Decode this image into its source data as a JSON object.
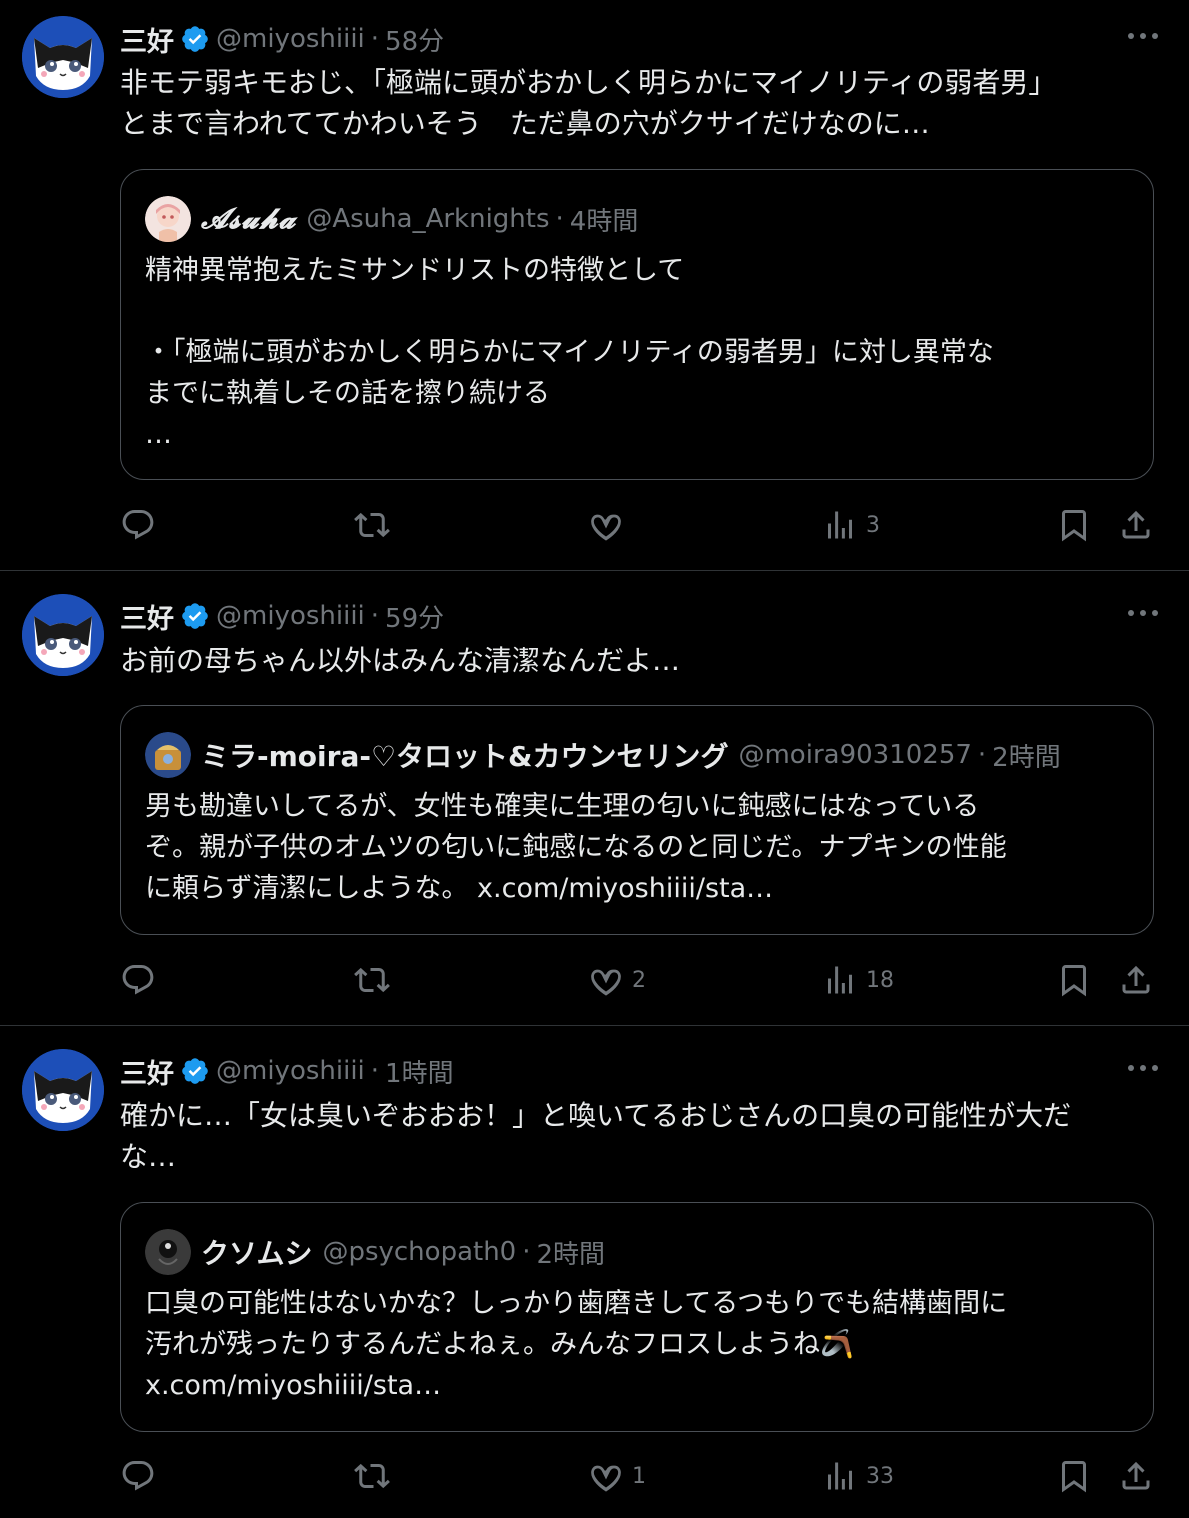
{
  "tweets": [
    {
      "name": "三好",
      "handle": "@miyoshiiii",
      "time": "58分",
      "text": "非モテ弱キモおじ、「極端に頭がおかしく明らかにマイノリティの弱者男」\nとまで言われててかわいそう　ただ鼻の穴がクサイだけなのに…",
      "quote": {
        "name": "𝓐𝓼𝓾𝓱𝓪",
        "handle": "@Asuha_Arknights",
        "time": "4時間",
        "text": "精神異常抱えたミサンドリストの特徴として\n\n・「極端に頭がおかしく明らかにマイノリティの弱者男」に対し異常な\nまでに執着しその話を擦り続ける\n…"
      },
      "actions": {
        "reply": "",
        "retweet": "",
        "like": "",
        "views": "3"
      }
    },
    {
      "name": "三好",
      "handle": "@miyoshiiii",
      "time": "59分",
      "text": "お前の母ちゃん以外はみんな清潔なんだよ…",
      "quote": {
        "name": "ミラ-moira-♡タロット&カウンセリング",
        "handle": "@moira90310257",
        "time": "2時間",
        "text": "男も勘違いしてるが、女性も確実に生理の匂いに鈍感にはなっている\nぞ。親が子供のオムツの匂いに鈍感になるのと同じだ。ナプキンの性能\nに頼らず清潔にしような。 x.com/miyoshiiii/sta…"
      },
      "actions": {
        "reply": "",
        "retweet": "",
        "like": "2",
        "views": "18"
      }
    },
    {
      "name": "三好",
      "handle": "@miyoshiiii",
      "time": "1時間",
      "text": "確かに…「女は臭いぞおおお！」と喚いてるおじさんの口臭の可能性が大だ\nな…",
      "quote": {
        "name": "クソムシ",
        "handle": "@psychopath0",
        "time": "2時間",
        "text": "口臭の可能性はないかな？しっかり歯磨きしてるつもりでも結構歯間に\n汚れが残ったりするんだよねぇ。みんなフロスしようね🪃\nx.com/miyoshiiii/sta…"
      },
      "actions": {
        "reply": "",
        "retweet": "",
        "like": "1",
        "views": "33"
      }
    }
  ],
  "icons": {
    "more": "more-icon",
    "reply": "reply-icon",
    "retweet": "retweet-icon",
    "like": "like-icon",
    "views": "views-icon",
    "bookmark": "bookmark-icon",
    "share": "share-icon",
    "verified": "verified-badge-icon"
  },
  "colors": {
    "background": "#000000",
    "text": "#e7e9ea",
    "muted": "#71767b",
    "border": "#2f3336",
    "verified": "#1d9bf0",
    "avatar_bg": "#1d4fb8"
  }
}
